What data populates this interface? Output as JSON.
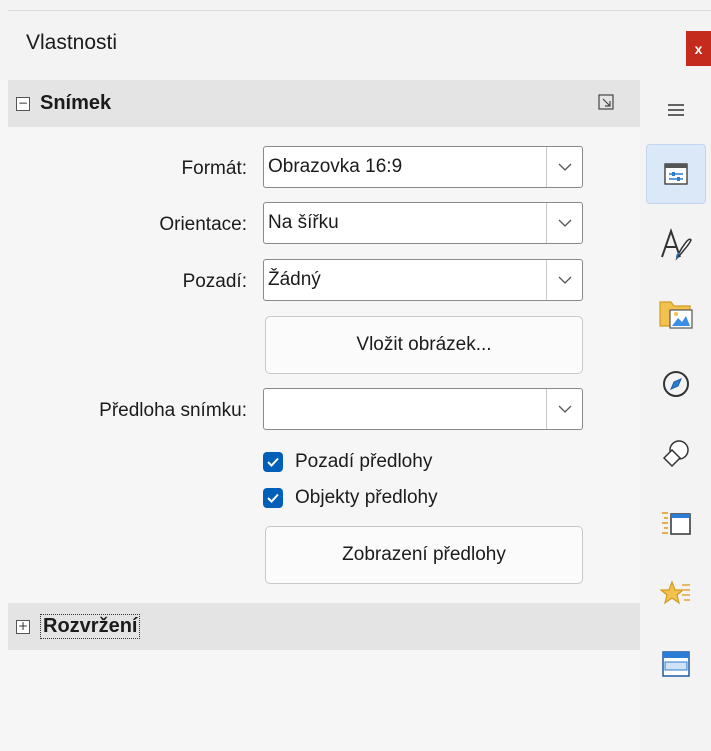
{
  "window": {
    "title": "Vlastnosti",
    "close_label": "x"
  },
  "slide_section": {
    "toggle": "−",
    "title": "Snímek",
    "format_label": "Formát:",
    "format_value": "Obrazovka 16:9",
    "orientation_label": "Orientace:",
    "orientation_value": "Na šířku",
    "background_label": "Pozadí:",
    "background_value": "Žádný",
    "insert_image_label": "Vložit obrázek...",
    "master_slide_label": "Předloha snímku:",
    "master_slide_value": "",
    "master_background_label": "Pozadí předlohy",
    "master_background_checked": true,
    "master_objects_label": "Objekty předlohy",
    "master_objects_checked": true,
    "master_view_label": "Zobrazení předlohy"
  },
  "layout_section": {
    "toggle": "+",
    "title": "Rozvržení"
  },
  "sidebar": {
    "items": [
      {
        "icon": "menu-icon"
      },
      {
        "icon": "properties-icon",
        "active": true
      },
      {
        "icon": "styles-icon"
      },
      {
        "icon": "gallery-icon"
      },
      {
        "icon": "navigator-icon"
      },
      {
        "icon": "shapes-icon"
      },
      {
        "icon": "slide-transition-icon"
      },
      {
        "icon": "animation-icon"
      },
      {
        "icon": "master-slides-icon"
      }
    ]
  },
  "colors": {
    "accent": "#005fb8",
    "close": "#c42b1c",
    "section_header": "#e4e4e4"
  }
}
